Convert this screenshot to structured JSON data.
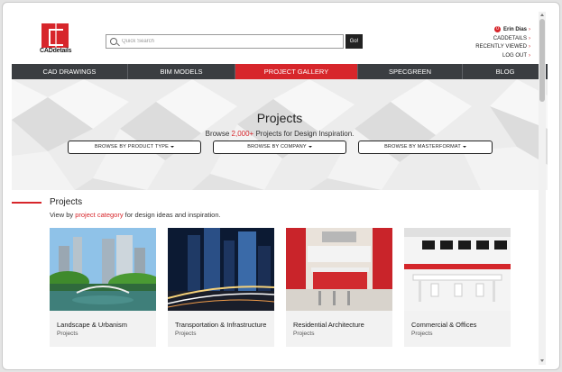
{
  "logo": {
    "text": "CADdetails"
  },
  "search": {
    "placeholder": "Quick Search",
    "button_label": "Go!"
  },
  "user": {
    "badge": "0",
    "name": "Erin Dias",
    "links": [
      "CADDETAILS",
      "RECENTLY VIEWED",
      "LOG OUT"
    ]
  },
  "nav": {
    "items": [
      {
        "label": "CAD DRAWINGS"
      },
      {
        "label": "BIM MODELS"
      },
      {
        "label": "PROJECT GALLERY"
      },
      {
        "label": "SPECGREEN"
      },
      {
        "label": "BLOG"
      }
    ],
    "active": "PROJECT GALLERY"
  },
  "hero": {
    "title": "Projects",
    "sub_pre": "Browse ",
    "sub_count": "2,000+",
    "sub_post": " Projects for Design Inspiration.",
    "browse": [
      "BROWSE BY PRODUCT TYPE",
      "BROWSE BY COMPANY",
      "BROWSE BY MASTERFORMAT"
    ]
  },
  "section": {
    "title": "Projects",
    "sub_pre": "View by ",
    "sub_link": "project category",
    "sub_post": " for design ideas and inspiration."
  },
  "cards": [
    {
      "title": "Landscape & Urbanism",
      "sub": "Projects"
    },
    {
      "title": "Transportation & Infrastructure",
      "sub": "Projects"
    },
    {
      "title": "Residential Architecture",
      "sub": "Projects"
    },
    {
      "title": "Commercial & Offices",
      "sub": "Projects"
    }
  ],
  "colors": {
    "accent": "#d7262b",
    "nav_bg": "#3a3d41"
  }
}
